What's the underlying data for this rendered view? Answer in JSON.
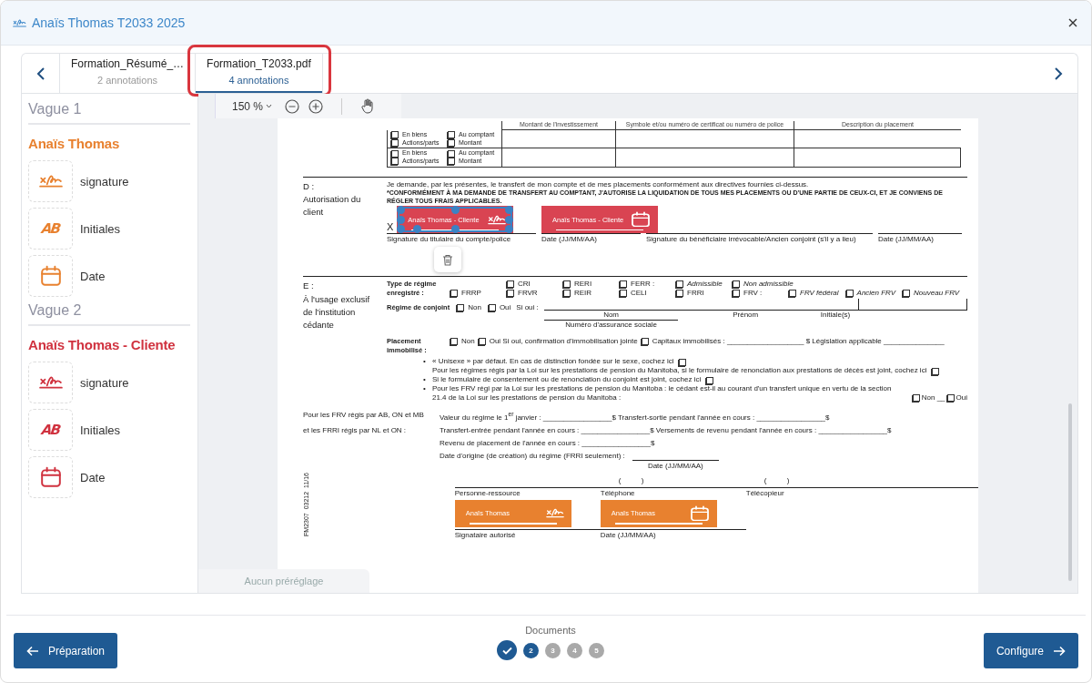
{
  "window": {
    "title": "Anaïs Thomas T2033 2025"
  },
  "tabs": [
    {
      "name": "Formation_Résumé_…",
      "count": "2 annotations",
      "selected": false,
      "highlighted": false
    },
    {
      "name": "Formation_T2033.pdf",
      "count": "4 annotations",
      "selected": true,
      "highlighted": true
    }
  ],
  "sidebar": {
    "groups": [
      {
        "title": "Vague 1",
        "signer": "Anaïs Thomas",
        "color": "#e8812f",
        "fields": [
          {
            "kind": "signature",
            "label": "signature"
          },
          {
            "kind": "initials",
            "glyph": "AB",
            "label": "Initiales"
          },
          {
            "kind": "date",
            "label": "Date"
          }
        ]
      },
      {
        "title": "Vague 2",
        "signer": "Anaïs Thomas - Cliente",
        "color": "#d0323f",
        "fields": [
          {
            "kind": "signature",
            "label": "signature"
          },
          {
            "kind": "initials",
            "glyph": "AB",
            "label": "Initiales"
          },
          {
            "kind": "date",
            "label": "Date"
          }
        ]
      }
    ]
  },
  "viewer": {
    "zoom": "150 %",
    "preset": "Aucun préréglage"
  },
  "document": {
    "table": {
      "columns": [
        "Montant de l'investissement",
        "Symbole et/ou numéro de certificat ou numéro de police",
        "Description du placement"
      ],
      "rows": [
        {
          "options": [
            {
              "label": "En biens",
              "checked": false
            },
            {
              "label": "Au comptant",
              "checked": false
            },
            {
              "label": "Actions/parts",
              "checked": false
            },
            {
              "label": "Montant",
              "checked": false
            }
          ]
        },
        {
          "options": [
            {
              "label": "En biens",
              "checked": false
            },
            {
              "label": "Au comptant",
              "checked": false
            },
            {
              "label": "Actions/parts",
              "checked": false
            },
            {
              "label": "Montant",
              "checked": false
            }
          ]
        }
      ]
    },
    "section_d": {
      "letter": "D :",
      "title": "Autorisation du client",
      "statement": "Je demande, par les présentes, le transfert de mon compte et de mes placements conformément aux directives fournies ci-dessus.",
      "notice": "*CONFORMÉMENT À MA DEMANDE DE TRANSFERT AU COMPTANT, J'AUTORISE LA LIQUIDATION DE TOUS MES PLACEMENTS OU D'UNE PARTIE DE CEUX-CI, ET JE CONVIENS DE RÉGLER TOUS FRAIS APPLICABLES.",
      "sign_mark": "X",
      "annotations": [
        {
          "signer": "Anaïs Thomas - Cliente",
          "kind": "signature",
          "color": "#d94452",
          "selected": true
        },
        {
          "signer": "Anaïs Thomas - Cliente",
          "kind": "date",
          "color": "#d94452",
          "selected": false
        }
      ],
      "lines": [
        "Signature du titulaire du compte/police",
        "Date (JJ/MM/AA)",
        "Signature du bénéficiaire irrévocable/Ancien conjoint (s'il y a lieu)",
        "Date (JJ/MM/AA)"
      ]
    },
    "section_e": {
      "letter": "E :",
      "title": "À l'usage exclusif de l'institution cédante",
      "plan_type_label": "Type de régime enregistré :",
      "plan_types": [
        [
          {
            "label": "CRI",
            "italic": false,
            "checked": false
          },
          {
            "label": "RERI",
            "italic": false,
            "checked": false
          },
          {
            "label": "FERR :",
            "italic": false,
            "checked": false
          },
          {
            "label": "Admissible",
            "italic": true,
            "checked": false
          },
          {
            "label": "Non admissible",
            "italic": true,
            "checked": false
          }
        ],
        [
          {
            "label": "FRRP",
            "italic": false,
            "checked": false
          },
          {
            "label": "FRVR",
            "italic": false,
            "checked": false
          },
          {
            "label": "REIR",
            "italic": false,
            "checked": false
          },
          {
            "label": "CELI",
            "italic": false,
            "checked": false
          },
          {
            "label": "FRRI",
            "italic": false,
            "checked": false
          },
          {
            "label": "FRV :",
            "italic": false,
            "checked": false
          },
          {
            "label": "FRV fédéral",
            "italic": true,
            "checked": false
          },
          {
            "label": "Ancien FRV",
            "italic": true,
            "checked": false
          },
          {
            "label": "Nouveau FRV",
            "italic": true,
            "checked": false
          }
        ]
      ],
      "spouse": {
        "label": "Régime de conjoint",
        "options": [
          {
            "label": "Non",
            "checked": false
          },
          {
            "label": "Oui",
            "checked": false
          }
        ],
        "if_yes": "Si oui :",
        "fields": [
          "Nom",
          "Prénom",
          "Initiale(s)",
          "Numéro d'assurance sociale"
        ]
      },
      "locked_in": {
        "label": "Placement immobilisé :",
        "options": [
          {
            "label": "Non",
            "checked": false
          },
          {
            "label": "Oui Si oui, confirmation d'immobilisation jointe",
            "checked": false
          },
          {
            "label": "Capitaux immobilisés : ___________________ $ Législation applicable _______________",
            "checked": false
          }
        ]
      },
      "notes": [
        {
          "marker": "•",
          "text": "« Unisexe » par défaut. En cas de distinction fondée sur le sexe, cochez ici",
          "checked": false
        },
        {
          "text": "Pour les régimes régis par la Loi sur les prestations de pension du Manitoba, si le formulaire de renonciation aux prestations de décès est joint, cochez ici",
          "checked": false
        },
        {
          "marker": "•",
          "text": "Si le formulaire de consentement ou de renonciation du conjoint est joint, cochez ici",
          "checked": false
        },
        {
          "marker": "•",
          "text": "Pour les FRV régi par la Loi sur les prestations de pension du Manitoba : le cédant est-il au courant d'un transfert unique en vertu de la section 21.4 de la Loi sur les prestations de pension du Manitoba :",
          "choices": [
            {
              "label": "Non __",
              "checked": false
            },
            {
              "label": "Oui",
              "checked": false
            }
          ]
        }
      ]
    },
    "frv": {
      "label_lines": [
        "Pour les FRV régis par AB, ON et MB",
        "et les FRRI régis par NL et ON :"
      ],
      "lines": [
        "Valeur du régime le 1$^{er}$ janvier : _________________$ Transfert-sortie pendant l'année en cours : _________________$",
        "Transfert-entrée pendant l'année en cours : _________________$ Versements de revenu pendant l'année en cours : _________________$",
        "Revenu de placement de l'année en cours : _________________$"
      ],
      "origin_label": "Date d'origine (de création) du régime (FRRI seulement) :",
      "origin_caption": "Date (JJ/MM/AA)"
    },
    "contacts": {
      "phone_marks": [
        "(          )",
        "(          )"
      ],
      "first_line": [
        "Personne-ressource",
        "Téléphone",
        "Télécopieur"
      ],
      "annotations": [
        {
          "signer": "Anaïs Thomas",
          "kind": "signature",
          "color": "#e8812f",
          "selected": false
        },
        {
          "signer": "Anaïs Thomas",
          "kind": "date",
          "color": "#e8812f",
          "selected": false
        }
      ],
      "second_line": [
        "Signataire autorisé",
        "Date (JJ/MM/AA)"
      ]
    },
    "form_code": "FM2307  03212  11/16"
  },
  "footer": {
    "back": "Préparation",
    "progress_label": "Documents",
    "steps": [
      {
        "done": true,
        "current": false
      },
      {
        "done": false,
        "current": true,
        "label": "2"
      },
      {
        "done": false,
        "current": false,
        "label": "3"
      },
      {
        "done": false,
        "current": false,
        "label": "4"
      },
      {
        "done": false,
        "current": false,
        "label": "5"
      }
    ],
    "next": "Configure"
  }
}
